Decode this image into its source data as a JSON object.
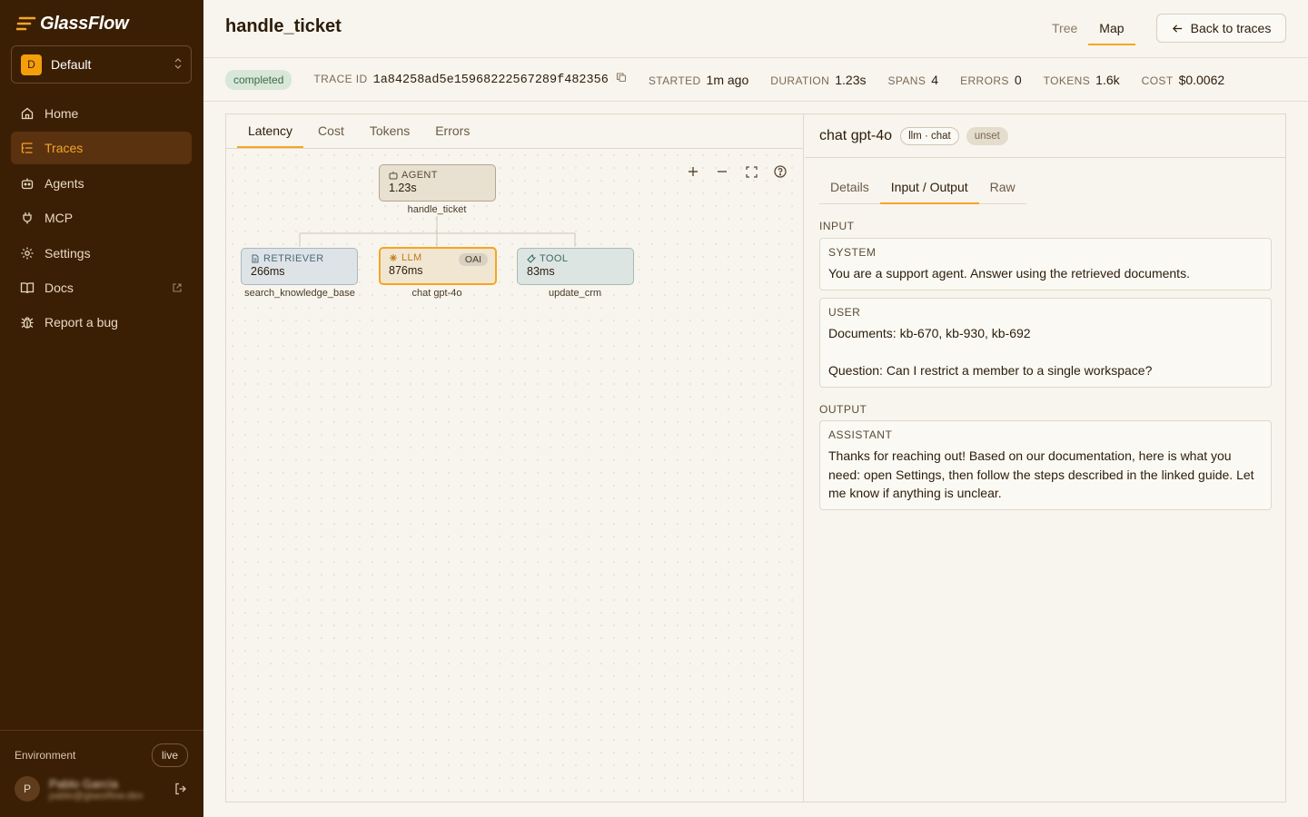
{
  "app": {
    "name": "GlassFlow"
  },
  "sidebar": {
    "workspace": {
      "initial": "D",
      "name": "Default"
    },
    "items": [
      {
        "label": "Home",
        "icon": "home-icon"
      },
      {
        "label": "Traces",
        "icon": "list-icon"
      },
      {
        "label": "Agents",
        "icon": "bot-icon"
      },
      {
        "label": "MCP",
        "icon": "plug-icon"
      },
      {
        "label": "Settings",
        "icon": "gear-icon"
      },
      {
        "label": "Docs",
        "icon": "book-icon"
      },
      {
        "label": "Report a bug",
        "icon": "bug-icon"
      }
    ],
    "active_item": "Traces",
    "environment_label": "Environment",
    "environment_value": "live",
    "user": {
      "initial": "P",
      "name": "Pablo García",
      "email": "pablo@glassflow.dev"
    }
  },
  "header": {
    "title": "handle_ticket",
    "view_tabs": [
      "Tree",
      "Map"
    ],
    "active_view": "Map",
    "back_label": "Back to traces"
  },
  "meta": {
    "status": "completed",
    "trace_id_label": "TRACE ID",
    "trace_id": "1a84258ad5e15968222567289f482356",
    "started_label": "STARTED",
    "started": "1m ago",
    "duration_label": "DURATION",
    "duration": "1.23s",
    "spans_label": "SPANS",
    "spans": "4",
    "errors_label": "ERRORS",
    "errors": "0",
    "tokens_label": "TOKENS",
    "tokens": "1.6k",
    "cost_label": "COST",
    "cost": "$0.0062"
  },
  "map": {
    "metric_tabs": [
      "Latency",
      "Cost",
      "Tokens",
      "Errors"
    ],
    "active_metric": "Latency",
    "nodes": {
      "agent": {
        "type": "AGENT",
        "duration": "1.23s",
        "name": "handle_ticket"
      },
      "retriever": {
        "type": "RETRIEVER",
        "duration": "266ms",
        "name": "search_knowledge_base"
      },
      "llm": {
        "type": "LLM",
        "duration": "876ms",
        "name": "chat gpt-4o",
        "badge": "OAI"
      },
      "tool": {
        "type": "TOOL",
        "duration": "83ms",
        "name": "update_crm"
      }
    }
  },
  "detail": {
    "title": "chat gpt-4o",
    "kind": "llm · chat",
    "status": "unset",
    "tabs": [
      "Details",
      "Input / Output",
      "Raw"
    ],
    "active_tab": "Input / Output",
    "input_label": "INPUT",
    "output_label": "OUTPUT",
    "system": {
      "role": "SYSTEM",
      "text": "You are a support agent. Answer using the retrieved documents."
    },
    "user": {
      "role": "USER",
      "text": "Documents: kb-670, kb-930, kb-692\n\nQuestion: Can I restrict a member to a single workspace?"
    },
    "assistant": {
      "role": "ASSISTANT",
      "text": "Thanks for reaching out! Based on our documentation, here is what you need: open Settings, then follow the steps described in the linked guide. Let me know if anything is unclear."
    }
  },
  "colors": {
    "sidebar_bg": "#3b1f04",
    "accent": "#f5a524",
    "page_bg": "#f8f5ee",
    "status_completed_bg": "#d9e7d9"
  }
}
